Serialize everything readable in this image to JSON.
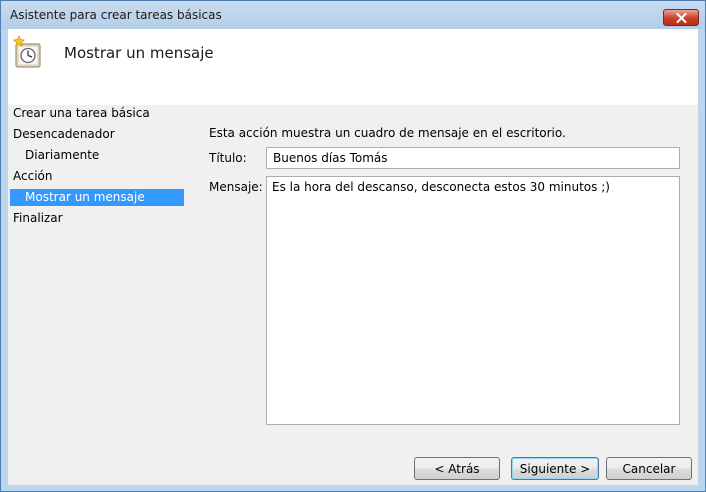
{
  "window": {
    "title": "Asistente para crear tareas básicas"
  },
  "header": {
    "title": "Mostrar un mensaje",
    "icon": "clock-task-icon"
  },
  "nav": {
    "items": [
      {
        "label": "Crear una tarea básica",
        "selected": false
      },
      {
        "label": "Desencadenador",
        "selected": false
      },
      {
        "label": "Diariamente",
        "selected": false
      },
      {
        "label": "Acción",
        "selected": false
      },
      {
        "label": "Mostrar un mensaje",
        "selected": true
      },
      {
        "label": "Finalizar",
        "selected": false
      }
    ]
  },
  "main": {
    "description": "Esta acción muestra un cuadro de mensaje en el escritorio.",
    "title_label": "Título:",
    "title_value": "Buenos días Tomás",
    "message_label": "Mensaje:",
    "message_value": "Es la hora del descanso, desconecta estos 30 minutos ;)"
  },
  "buttons": {
    "back": "< Atrás",
    "next": "Siguiente >",
    "cancel": "Cancelar"
  },
  "colors": {
    "selection": "#3399ff",
    "frame": "#bcd6ee",
    "close": "#c7412a"
  }
}
